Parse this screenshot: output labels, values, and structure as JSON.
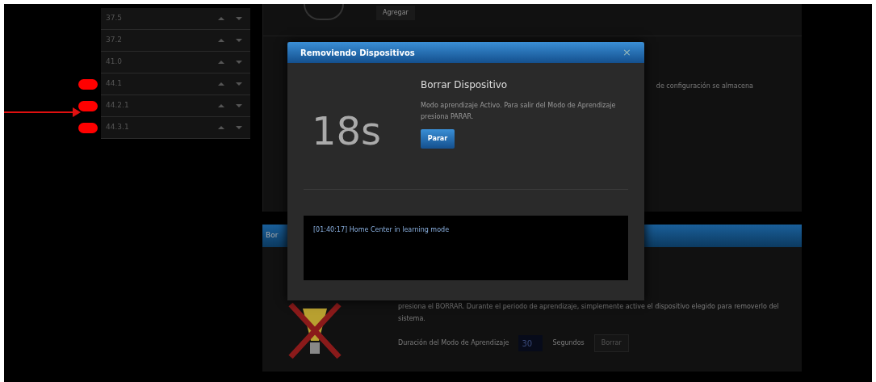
{
  "device_list": [
    {
      "label": "37.5",
      "marked": false
    },
    {
      "label": "37.2",
      "marked": false
    },
    {
      "label": "41.0",
      "marked": false
    },
    {
      "label": "44.1",
      "marked": true
    },
    {
      "label": "44.2.1",
      "marked": true
    },
    {
      "label": "44.3.1",
      "marked": true
    }
  ],
  "top_panel": {
    "button": "Agregar",
    "text": "de configuración se almacena"
  },
  "bottom_panel": {
    "header": "Bor",
    "text": "presiona el BORRAR. Durante el periodo de aprendizaje, simplemente active el dispositivo elegido para removerlo del sistema.",
    "duration_label": "Duración del Modo de Aprendizaje",
    "duration_value": "30",
    "unit": "Segundos",
    "button": "Borrar"
  },
  "dialog": {
    "title": "Removiendo Dispositivos",
    "close": "×",
    "heading": "Borrar Dispositivo",
    "countdown": "18s",
    "message": "Modo aprendizaje Activo. Para salir del Modo de Aprendizaje presiona PARAR.",
    "button": "Parar",
    "log": [
      "[01:40:17] Home Center in learning mode"
    ]
  }
}
